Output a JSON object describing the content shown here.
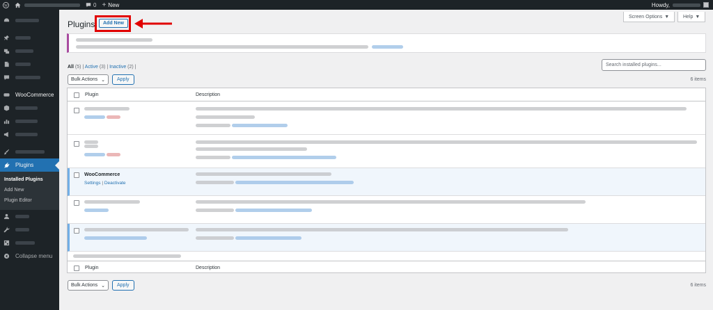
{
  "admin_bar": {
    "wp_logo_icon": "wordpress-logo-icon",
    "home_icon": "home-icon",
    "comments_count": "0",
    "new_label": "New",
    "howdy_label": "Howdy,"
  },
  "sidebar": {
    "woocommerce_label": "WooCommerce",
    "plugins_label": "Plugins",
    "submenu": [
      "Installed Plugins",
      "Add New",
      "Plugin Editor"
    ],
    "collapse_label": "Collapse menu"
  },
  "screen_options": {
    "label": "Screen Options",
    "help_label": "Help"
  },
  "page": {
    "title": "Plugins",
    "add_new_label": "Add New"
  },
  "filters": {
    "all_label": "All",
    "all_count": "(5)",
    "active_label": "Active",
    "active_count": "(3)",
    "inactive_label": "Inactive",
    "inactive_count": "(2)"
  },
  "search": {
    "placeholder": "Search installed plugins..."
  },
  "bulk": {
    "label": "Bulk Actions",
    "apply_label": "Apply"
  },
  "items_count": "6 items",
  "table": {
    "col_plugin": "Plugin",
    "col_description": "Description",
    "woocommerce_row": {
      "name": "WooCommerce",
      "settings_link": "Settings",
      "deactivate_link": "Deactivate"
    }
  },
  "colors": {
    "accent": "#2271b1",
    "highlight": "#e10000",
    "sidebar_bg": "#1d2327",
    "active_border": "#72aee6"
  }
}
